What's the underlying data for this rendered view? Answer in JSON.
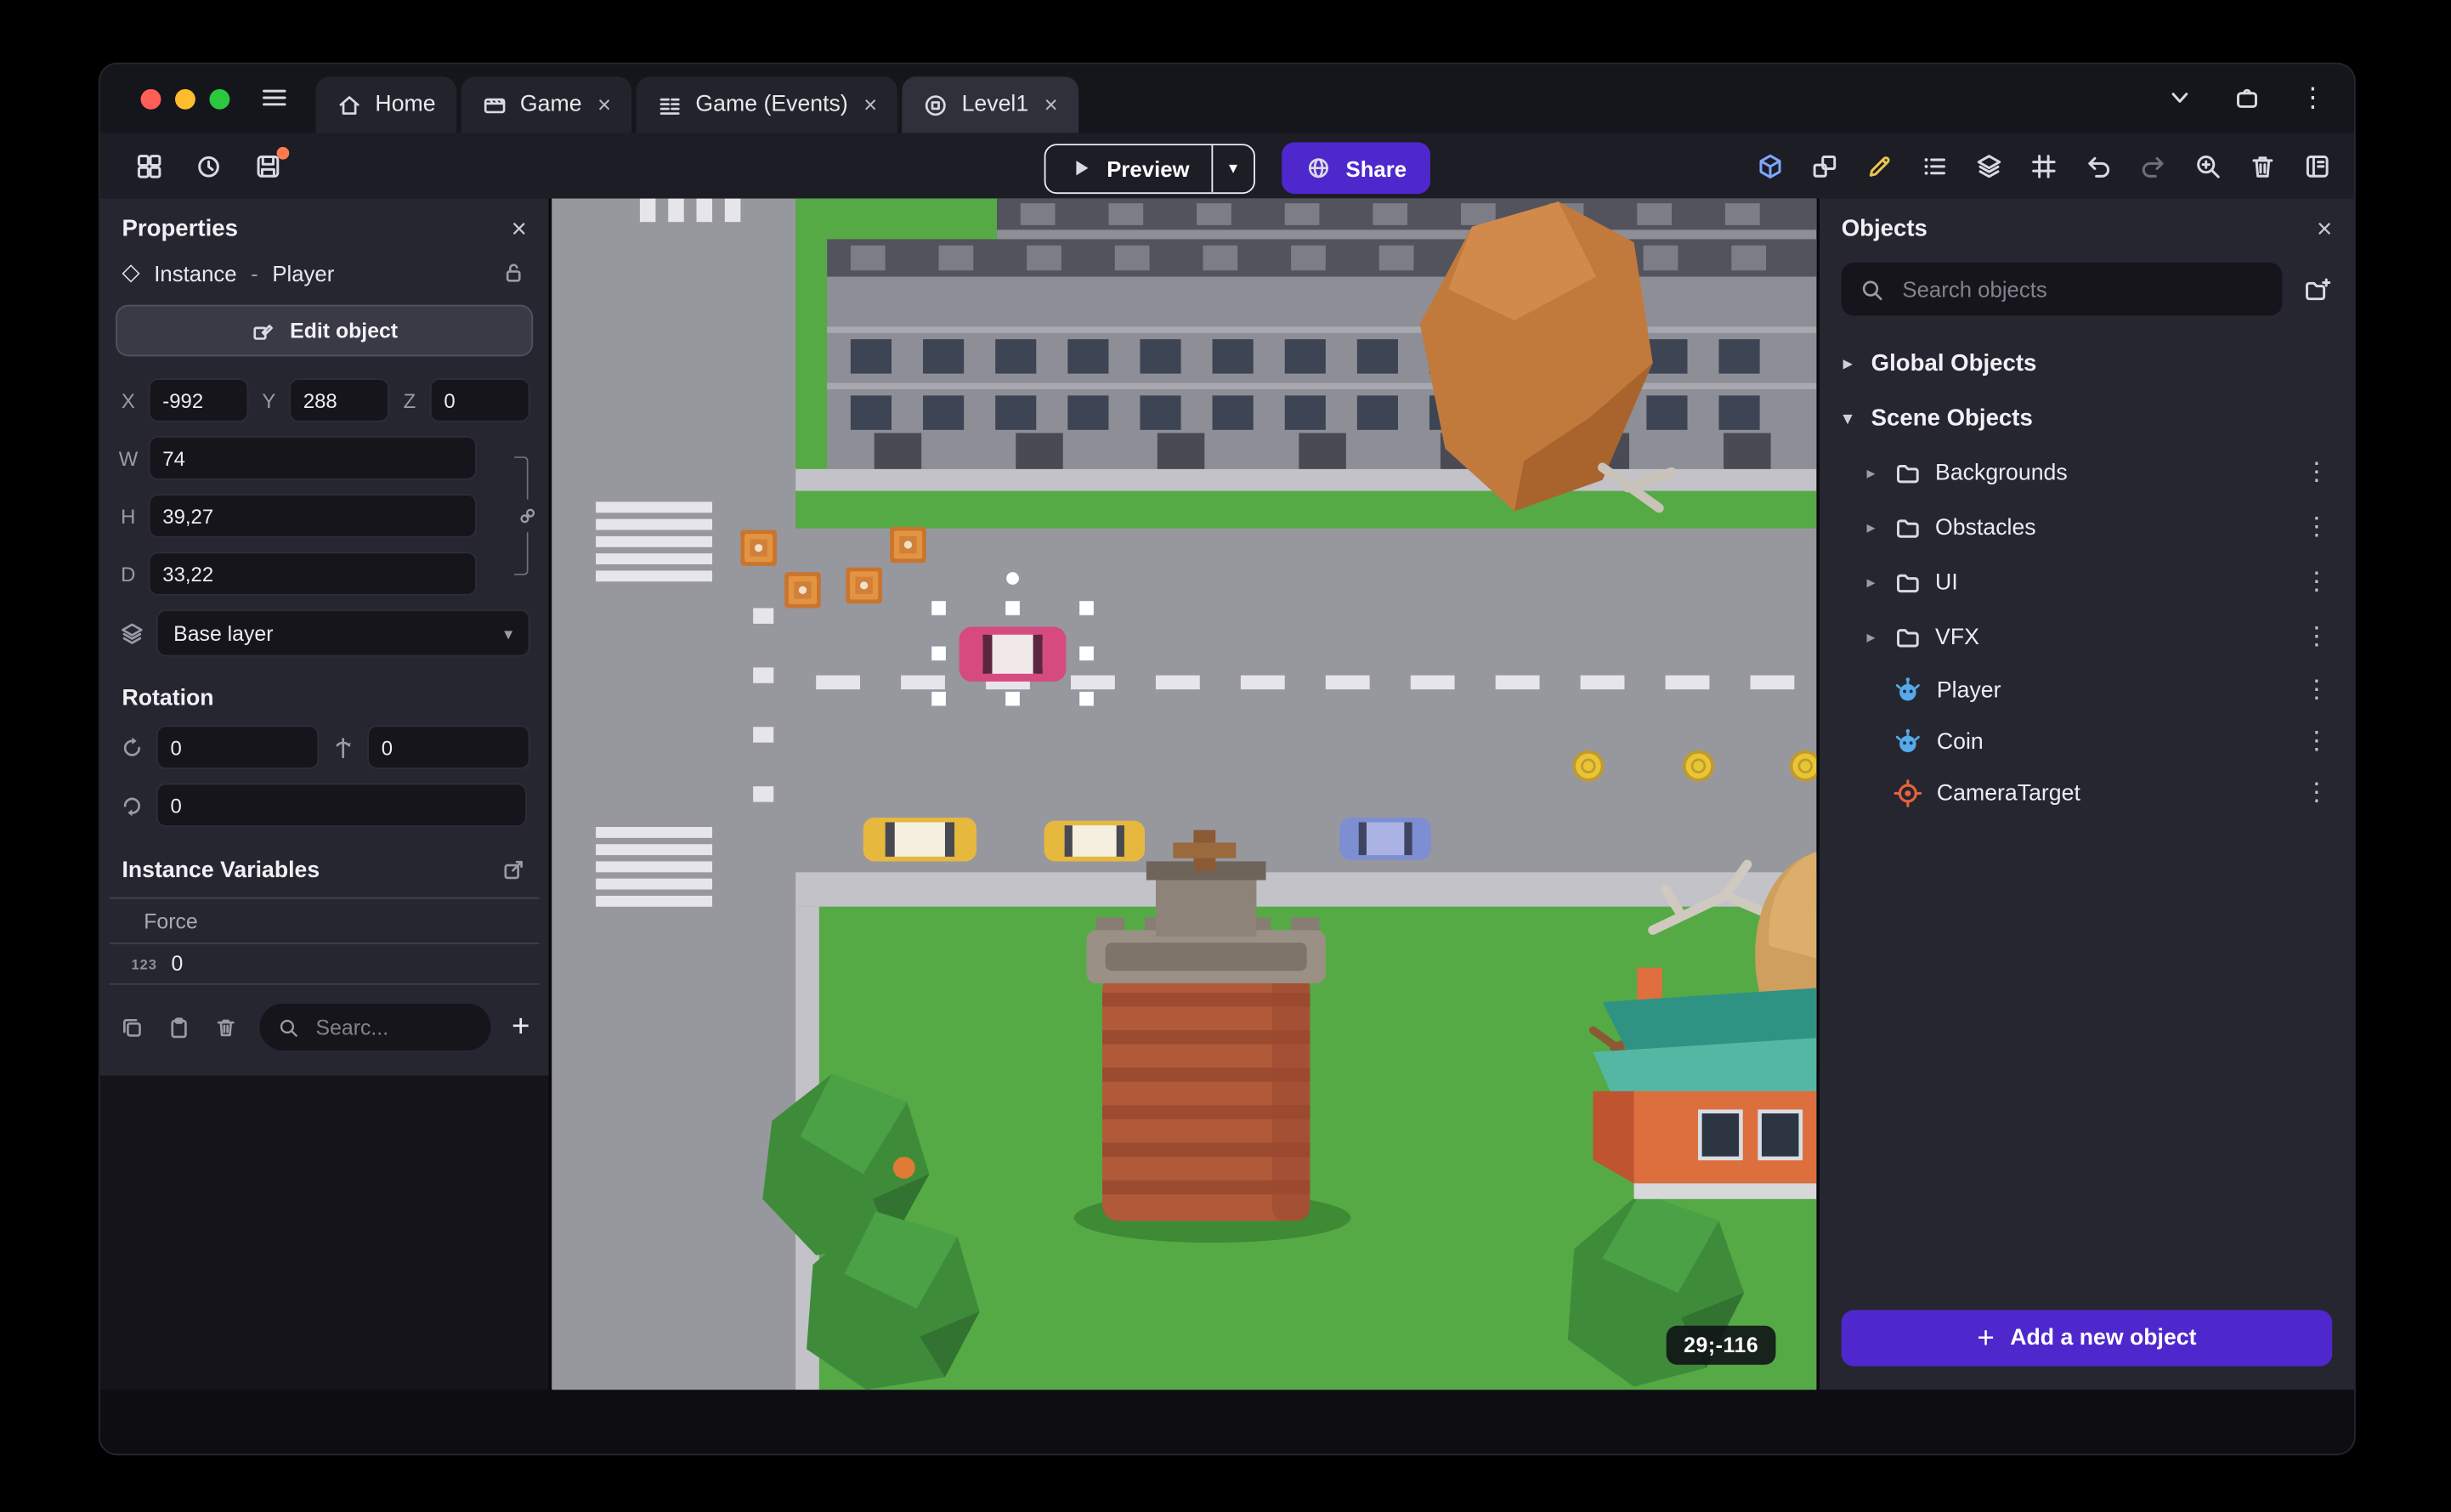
{
  "glyphs": {
    "close": "×",
    "kebab": "⋮",
    "tri_down": "▾",
    "tri_right": "▸",
    "plus": "+",
    "diamond": "◇",
    "caret": "▾"
  },
  "window": {
    "tabs": [
      {
        "label": "Home"
      },
      {
        "label": "Game"
      },
      {
        "label": "Game (Events)"
      },
      {
        "label": "Level1"
      }
    ]
  },
  "toolbar": {
    "preview": "Preview",
    "share": "Share"
  },
  "properties": {
    "title": "Properties",
    "instance_type": "Instance",
    "separator": "-",
    "instance_name": "Player",
    "edit_object": "Edit object",
    "labels": {
      "x": "X",
      "y": "Y",
      "z": "Z",
      "w": "W",
      "h": "H",
      "d": "D"
    },
    "values": {
      "x": "-992",
      "y": "288",
      "z": "0",
      "w": "74",
      "h": "39,27",
      "d": "33,22"
    },
    "layer": "Base layer",
    "rotation_title": "Rotation",
    "rotation": {
      "r1": "0",
      "r2": "0",
      "r3": "0"
    },
    "variables_title": "Instance Variables",
    "variable_name": "Force",
    "variable_badge": "123",
    "variable_value": "0",
    "search_placeholder": "Searc..."
  },
  "canvas": {
    "coords_badge": "29;-116"
  },
  "objects": {
    "title": "Objects",
    "search_placeholder": "Search objects",
    "global_label": "Global Objects",
    "scene_label": "Scene Objects",
    "folders": [
      {
        "label": "Backgrounds"
      },
      {
        "label": "Obstacles"
      },
      {
        "label": "UI"
      },
      {
        "label": "VFX"
      }
    ],
    "items": [
      {
        "label": "Player",
        "icon": "sprite-icon"
      },
      {
        "label": "Coin",
        "icon": "sprite-icon"
      },
      {
        "label": "CameraTarget",
        "icon": "camera-target-icon"
      }
    ],
    "add_button": "Add a new object"
  },
  "colors": {
    "accent_purple": "#4e28cc",
    "toolbar_highlight_blue": "#7fa7ff",
    "toolbar_highlight_yellow": "#e9c64f",
    "grass_green": "#55aa45",
    "road_gray": "#97979e",
    "selected_object_pink": "#d64a80",
    "badge_orange": "#ff7a4d"
  }
}
